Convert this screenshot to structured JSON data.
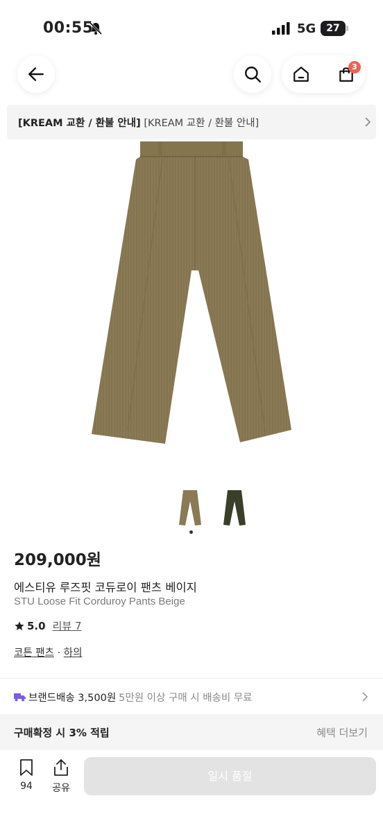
{
  "status_bar": {
    "time": "00:55",
    "network": "5G",
    "battery": "27"
  },
  "nav": {
    "cart_count": "3"
  },
  "notice": {
    "bold": "[KREAM 교환 / 환불 안내]",
    "rest": "[KREAM 교환 / 환불 안내]"
  },
  "product": {
    "price": "209,000원",
    "name_ko": "에스티유 루즈핏 코듀로이 팬츠 베이지",
    "name_en": "STU Loose Fit Corduroy Pants Beige",
    "rating": "5.0",
    "review_label": "리뷰 7",
    "category": "코튼 팬츠",
    "separator": "·",
    "subcategory": "하의",
    "image_color": "#8a7a55",
    "thumb_colors": [
      "#8a7a55",
      "#3a3f2a"
    ]
  },
  "delivery": {
    "label": "브랜드배송 3,500원",
    "note": "5만원 이상 구매 시 배송비 무료",
    "icon_color": "#7a5ce6"
  },
  "points": {
    "label": "구매확정 시 3% 적립",
    "more": "혜택 더보기"
  },
  "bottom": {
    "save_count": "94",
    "share_label": "공유",
    "soldout_label": "일시 품절"
  }
}
